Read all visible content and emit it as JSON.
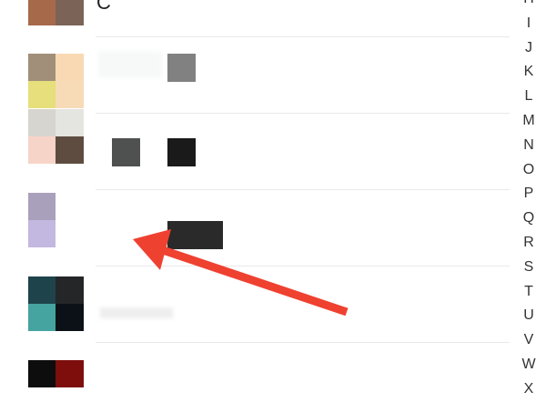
{
  "contact_list": {
    "partial_name": "C",
    "rows": [
      {
        "id": "row-top"
      },
      {
        "id": "row-1"
      },
      {
        "id": "row-2"
      },
      {
        "id": "row-3"
      },
      {
        "id": "row-4"
      }
    ]
  },
  "index_bar": {
    "letters": [
      "H",
      "I",
      "J",
      "K",
      "L",
      "M",
      "N",
      "O",
      "P",
      "Q",
      "R",
      "S",
      "T",
      "U",
      "V",
      "W",
      "X"
    ]
  },
  "colors": {
    "arrow": "#ef4130",
    "divider": "#e9e9e9",
    "text": "#333333"
  }
}
